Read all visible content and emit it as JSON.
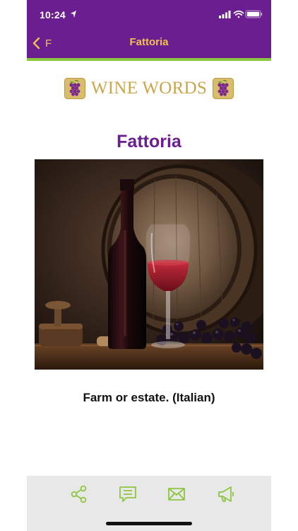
{
  "status_bar": {
    "time": "10:24"
  },
  "nav": {
    "back_label": "F",
    "title": "Fattoria"
  },
  "logo": {
    "text": "WINE WORDS"
  },
  "entry": {
    "term": "Fattoria",
    "definition": "Farm or estate. (Italian)"
  },
  "toolbar": {
    "items": [
      "share-icon",
      "comment-icon",
      "mail-icon",
      "megaphone-icon"
    ]
  },
  "colors": {
    "header": "#6b1e8f",
    "accent": "#8cc63f",
    "nav_text": "#f2c14e",
    "logo_gold": "#c9a64a",
    "term_purple": "#6b1e8f",
    "toolbar_icon": "#8cc63f",
    "toolbar_bg": "#e8e8e8"
  }
}
